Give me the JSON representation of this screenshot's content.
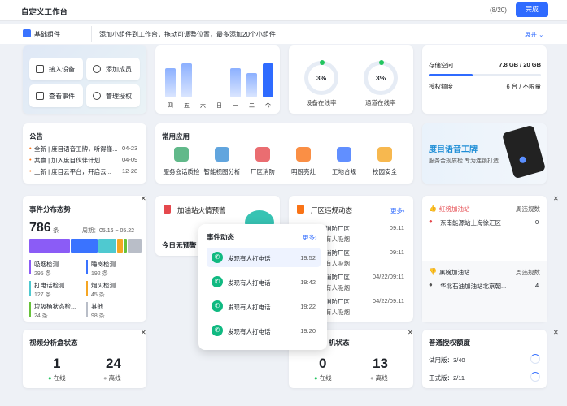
{
  "header": {
    "title": "自定义工作台",
    "count": "(8/20)",
    "done_label": "完成"
  },
  "subbar": {
    "category": "基础组件",
    "tip": "添加小组件到工作台，拖动可调整位置，最多添加20个小组件",
    "expand": "展开 ⌄"
  },
  "quick": [
    "接入设备",
    "添加成员",
    "查看事件",
    "管理授权"
  ],
  "weekchart": {
    "days": [
      "四",
      "五",
      "六",
      "日",
      "一",
      "二",
      "今"
    ],
    "values": [
      6,
      7,
      0,
      0,
      6,
      5,
      7
    ],
    "highlight_index": 6
  },
  "rings": [
    {
      "value": "3%",
      "label": "设备在线率"
    },
    {
      "value": "3%",
      "label": "通道在线率"
    }
  ],
  "storage": {
    "label1": "存储空间",
    "value1": "7.8 GB / 20 GB",
    "fill": 0.39,
    "label2": "授权额度",
    "value2": "6 台 / 不限量"
  },
  "notice": {
    "title": "公告",
    "items": [
      {
        "text": "全新 | 度目语音工牌，听得懂...",
        "date": "04-23"
      },
      {
        "text": "共赢 | 加入度目伙伴计划",
        "date": "04-09"
      },
      {
        "text": "上新 | 度目云平台，开启云...",
        "date": "12-28"
      }
    ]
  },
  "apps": {
    "title": "常用应用",
    "items": [
      "服务会话质检",
      "智能视图分析",
      "厂区消防",
      "明厨亮灶",
      "工地合规",
      "校园安全"
    ]
  },
  "banner": {
    "title": "度目语音工牌",
    "sub": "服务合规质检 专为连锁打造"
  },
  "events": {
    "title": "事件分布态势",
    "total": "786",
    "unit": "条",
    "period": "周期：05.16 ~ 05.22",
    "legend": [
      {
        "name": "吸烟检测",
        "num": "295 条"
      },
      {
        "name": "睡岗检测",
        "num": "192 条"
      },
      {
        "name": "打电话检测",
        "num": "127 条"
      },
      {
        "name": "烟火检测",
        "num": "45 条"
      },
      {
        "name": "垃圾桶状态检...",
        "num": "24 条"
      },
      {
        "name": "其他",
        "num": "98 条"
      }
    ],
    "shares": [
      295,
      192,
      127,
      45,
      24,
      98
    ],
    "colors": [
      "#8b5cf6",
      "#3a73ff",
      "#4fc9d0",
      "#f5a623",
      "#67c23a",
      "#b9bec8"
    ]
  },
  "fire": {
    "title": "加油站火情预警",
    "none": "今日无预警"
  },
  "factory": {
    "title": "厂区违规动态",
    "more": "更多›",
    "rows": [
      {
        "a": "消防厂区",
        "b": "有人吸烟",
        "t": "09:11"
      },
      {
        "a": "消防厂区",
        "b": "有人吸烟",
        "t": "09:11"
      },
      {
        "a": "消防厂区",
        "b": "有人吸烟",
        "t": "04/22/09:11"
      },
      {
        "a": "消防厂区",
        "b": "有人吸烟",
        "t": "04/22/09:11"
      }
    ]
  },
  "redlist": {
    "title": "红榜加油站",
    "col": "周违规数",
    "rows": [
      {
        "name": "东南能源站上海徐汇区",
        "n": "0"
      }
    ]
  },
  "blacklist": {
    "title": "黑榜加油站",
    "col": "周违规数",
    "rows": [
      {
        "name": "华北石油加油站北京朝...",
        "n": "4"
      }
    ]
  },
  "popup": {
    "title": "事件动态",
    "more": "更多›",
    "items": [
      {
        "text": "发现有人打电话",
        "time": "19:52"
      },
      {
        "text": "发现有人打电话",
        "time": "19:42"
      },
      {
        "text": "发现有人打电话",
        "time": "19:22"
      },
      {
        "text": "发现有人打电话",
        "time": "19:20"
      }
    ]
  },
  "video": {
    "title": "视频分析盒状态",
    "online": "1",
    "offline": "24",
    "online_label": "在线",
    "offline_label": "离线"
  },
  "machine": {
    "title": "机状态",
    "online": "0",
    "offline": "13",
    "online_label": "在线",
    "offline_label": "离线"
  },
  "quota": {
    "title": "普通授权额度",
    "trial": "试用版：3/40",
    "formal": "正式版：2/11"
  }
}
